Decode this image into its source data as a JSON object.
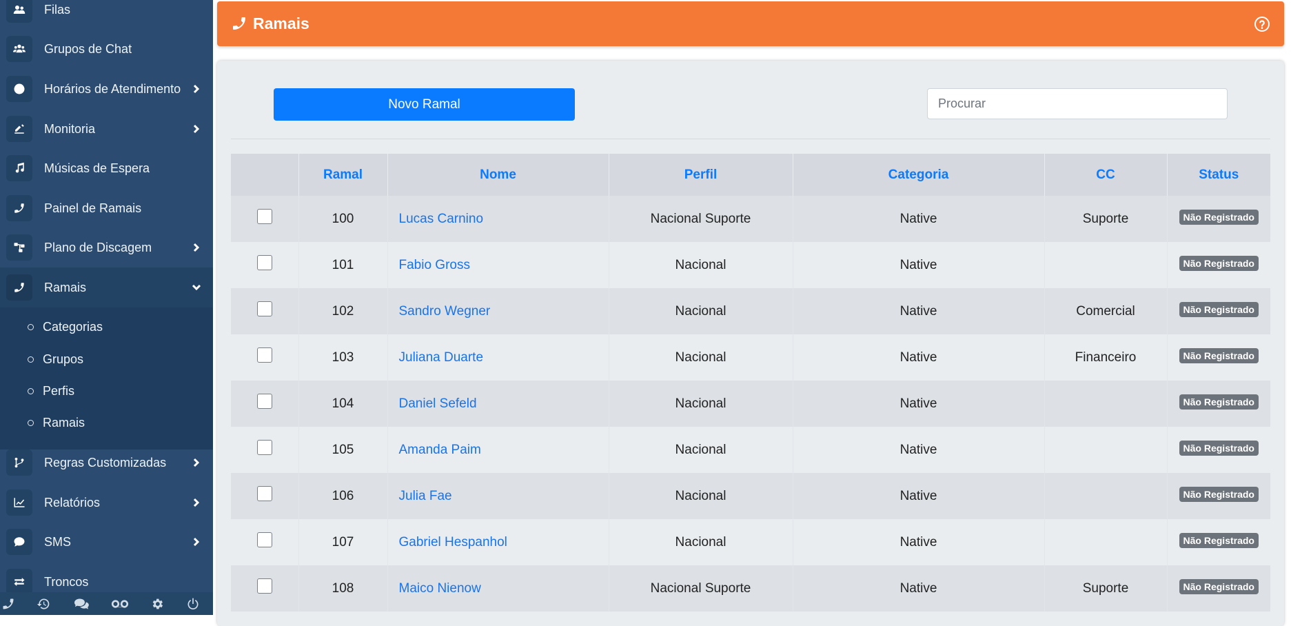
{
  "sidebar": {
    "items": [
      {
        "label": "Filas",
        "icon": "users-icon",
        "chevron": false
      },
      {
        "label": "Grupos de Chat",
        "icon": "users-group-icon",
        "chevron": false
      },
      {
        "label": "Horários de Atendimento",
        "icon": "clock-icon",
        "chevron": true
      },
      {
        "label": "Monitoria",
        "icon": "signature-icon",
        "chevron": true
      },
      {
        "label": "Músicas de Espera",
        "icon": "music-icon",
        "chevron": false
      },
      {
        "label": "Painel de Ramais",
        "icon": "phone-icon",
        "chevron": false
      },
      {
        "label": "Plano de Discagem",
        "icon": "sitemap-icon",
        "chevron": true
      },
      {
        "label": "Ramais",
        "icon": "phone-icon",
        "chevron": true,
        "expanded": true
      },
      {
        "label": "Regras Customizadas",
        "icon": "code-branch-icon",
        "chevron": true
      },
      {
        "label": "Relatórios",
        "icon": "chart-line-icon",
        "chevron": true
      },
      {
        "label": "SMS",
        "icon": "sms-icon",
        "chevron": true
      },
      {
        "label": "Troncos",
        "icon": "exchange-icon",
        "chevron": false
      }
    ],
    "submenu": [
      {
        "label": "Categorias"
      },
      {
        "label": "Grupos"
      },
      {
        "label": "Perfis"
      },
      {
        "label": "Ramais"
      }
    ],
    "footer_icons": [
      "phone-icon",
      "history-icon",
      "comments-icon",
      "voicemail-icon",
      "gear-icon",
      "power-icon"
    ]
  },
  "header": {
    "title": "Ramais",
    "icon": "phone-icon",
    "help_icon": "question-circle-icon",
    "color": "#f47836"
  },
  "toolbar": {
    "new_button_label": "Novo Ramal",
    "search_placeholder": "Procurar",
    "search_value": ""
  },
  "table": {
    "columns": [
      "",
      "Ramal",
      "Nome",
      "Perfil",
      "Categoria",
      "CC",
      "Status"
    ],
    "rows": [
      {
        "ramal": "100",
        "nome": "Lucas Carnino",
        "perfil": "Nacional Suporte",
        "categoria": "Native",
        "cc": "Suporte",
        "status": "Não Registrado"
      },
      {
        "ramal": "101",
        "nome": "Fabio Gross",
        "perfil": "Nacional",
        "categoria": "Native",
        "cc": "",
        "status": "Não Registrado"
      },
      {
        "ramal": "102",
        "nome": "Sandro Wegner",
        "perfil": "Nacional",
        "categoria": "Native",
        "cc": "Comercial",
        "status": "Não Registrado"
      },
      {
        "ramal": "103",
        "nome": "Juliana Duarte",
        "perfil": "Nacional",
        "categoria": "Native",
        "cc": "Financeiro",
        "status": "Não Registrado"
      },
      {
        "ramal": "104",
        "nome": "Daniel Sefeld",
        "perfil": "Nacional",
        "categoria": "Native",
        "cc": "",
        "status": "Não Registrado"
      },
      {
        "ramal": "105",
        "nome": "Amanda Paim",
        "perfil": "Nacional",
        "categoria": "Native",
        "cc": "",
        "status": "Não Registrado"
      },
      {
        "ramal": "106",
        "nome": "Julia Fae",
        "perfil": "Nacional",
        "categoria": "Native",
        "cc": "",
        "status": "Não Registrado"
      },
      {
        "ramal": "107",
        "nome": "Gabriel Hespanhol",
        "perfil": "Nacional",
        "categoria": "Native",
        "cc": "",
        "status": "Não Registrado"
      },
      {
        "ramal": "108",
        "nome": "Maico Nienow",
        "perfil": "Nacional Suporte",
        "categoria": "Native",
        "cc": "Suporte",
        "status": "Não Registrado"
      }
    ]
  }
}
